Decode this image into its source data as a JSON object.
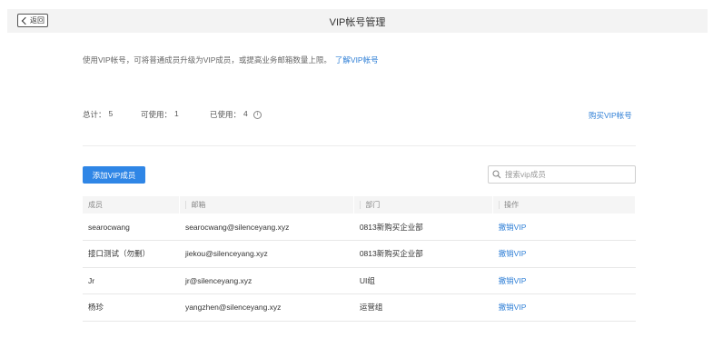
{
  "header": {
    "back_label": "返回",
    "title": "VIP帐号管理"
  },
  "intro": {
    "text": "使用VIP帐号，可将普通成员升级为VIP成员，或提高业务邮箱数量上限。",
    "link": "了解VIP帐号"
  },
  "stats": {
    "total_label": "总计：",
    "total_value": "5",
    "available_label": "可使用：",
    "available_value": "1",
    "used_label": "已使用：",
    "used_value": "4"
  },
  "buy_link": "购买VIP帐号",
  "add_button": "添加VIP成员",
  "search": {
    "placeholder": "搜索vip成员"
  },
  "table": {
    "headers": [
      "成员",
      "邮箱",
      "部门",
      "操作"
    ],
    "rows": [
      {
        "member": "searocwang",
        "email": "searocwang@silenceyang.xyz",
        "dept": "0813新购买企业部",
        "action": "撤销VIP"
      },
      {
        "member": "接口测试（勿删）",
        "email": "jiekou@silenceyang.xyz",
        "dept": "0813新购买企业部",
        "action": "撤销VIP"
      },
      {
        "member": "Jr",
        "email": "jr@silenceyang.xyz",
        "dept": "UI组",
        "action": "撤销VIP"
      },
      {
        "member": "杨珍",
        "email": "yangzhen@silenceyang.xyz",
        "dept": "运营组",
        "action": "撤销VIP"
      }
    ]
  },
  "colors": {
    "accent": "#2f86e6",
    "link": "#2f7fd6",
    "header_bg": "#f3f3f3"
  },
  "icons": {
    "back": "chevron-left-icon",
    "info": "info-icon",
    "search": "search-icon"
  }
}
